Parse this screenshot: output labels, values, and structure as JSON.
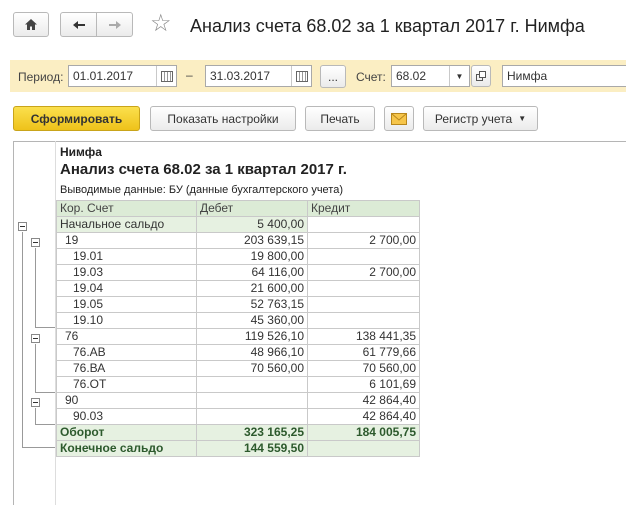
{
  "toolbar": {
    "title": "Анализ счета 68.02 за 1 квартал 2017 г. Нимфа",
    "home_icon": "home-icon",
    "back_icon": "arrow-left-icon",
    "forward_icon": "arrow-right-icon",
    "favorite_icon": "star-icon"
  },
  "filter": {
    "period_label": "Период:",
    "date_from": "01.01.2017",
    "date_sep": "–",
    "date_to": "31.03.2017",
    "dots_label": "...",
    "account_label": "Счет:",
    "account_value": "68.02",
    "organization": "Нимфа"
  },
  "actions": {
    "generate": "Сформировать",
    "show_settings": "Показать настройки",
    "print": "Печать",
    "registry": "Регистр учета"
  },
  "report": {
    "org": "Нимфа",
    "heading": "Анализ счета 68.02 за 1 квартал 2017 г.",
    "data_shown": "Выводимые данные:  БУ (данные бухгалтерского учета)",
    "columns": [
      "Кор. Счет",
      "Дебет",
      "Кредит"
    ],
    "rows": [
      {
        "acc": "Начальное сальдо",
        "debit": "5 400,00",
        "credit": ""
      },
      {
        "acc": "19",
        "debit": "203 639,15",
        "credit": "2 700,00"
      },
      {
        "acc": "19.01",
        "debit": "19 800,00",
        "credit": ""
      },
      {
        "acc": "19.03",
        "debit": "64 116,00",
        "credit": "2 700,00"
      },
      {
        "acc": "19.04",
        "debit": "21 600,00",
        "credit": ""
      },
      {
        "acc": "19.05",
        "debit": "52 763,15",
        "credit": ""
      },
      {
        "acc": "19.10",
        "debit": "45 360,00",
        "credit": ""
      },
      {
        "acc": "76",
        "debit": "119 526,10",
        "credit": "138 441,35"
      },
      {
        "acc": "76.АВ",
        "debit": "48 966,10",
        "credit": "61 779,66"
      },
      {
        "acc": "76.ВА",
        "debit": "70 560,00",
        "credit": "70 560,00"
      },
      {
        "acc": "76.ОТ",
        "debit": "",
        "credit": "6 101,69"
      },
      {
        "acc": "90",
        "debit": "",
        "credit": "42 864,40"
      },
      {
        "acc": "90.03",
        "debit": "",
        "credit": "42 864,40"
      },
      {
        "acc": "Оборот",
        "debit": "323 165,25",
        "credit": "184 005,75"
      },
      {
        "acc": "Конечное сальдо",
        "debit": "144 559,50",
        "credit": ""
      }
    ]
  }
}
